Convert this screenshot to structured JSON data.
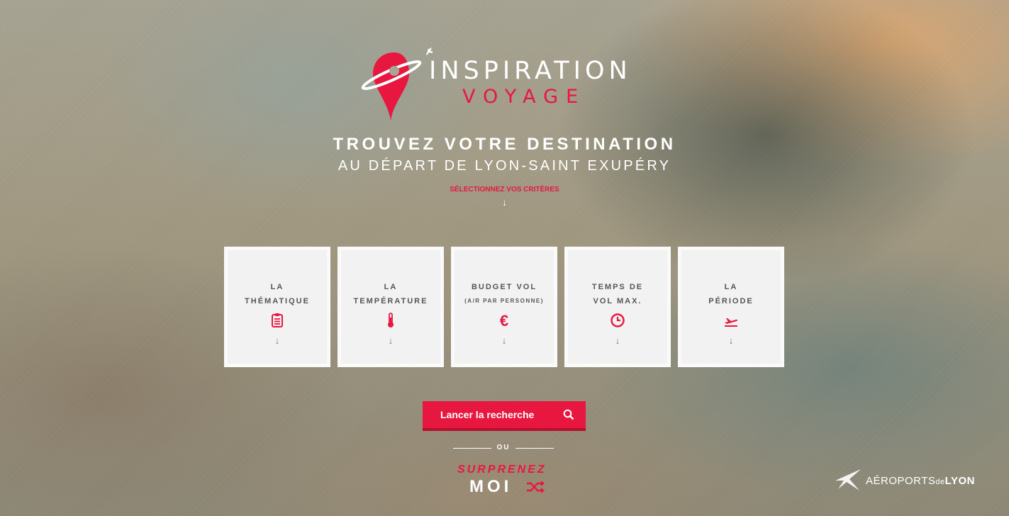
{
  "logo": {
    "line1": "INSPIRATION",
    "line2": "VOYAGE"
  },
  "hero": {
    "headline": "TROUVEZ VOTRE DESTINATION",
    "subheadline": "AU DÉPART DE LYON-SAINT EXUPÉRY",
    "criteria_hint": "SÉLECTIONNEZ VOS CRITÈRES",
    "arrow": "↓"
  },
  "criteria": [
    {
      "line1": "LA",
      "line2": "THÉMATIQUE",
      "icon": "clipboard-icon"
    },
    {
      "line1": "LA",
      "line2": "TEMPÉRATURE",
      "icon": "thermometer-icon"
    },
    {
      "line1": "BUDGET VOL",
      "note": "(A/R PAR PERSONNE)",
      "icon": "euro-icon"
    },
    {
      "line1": "TEMPS DE",
      "line2": "VOL MAX.",
      "icon": "clock-icon"
    },
    {
      "line1": "LA",
      "line2": "PÉRIODE",
      "icon": "plane-takeoff-icon"
    }
  ],
  "card_arrow": "↓",
  "search": {
    "label": "Lancer la recherche",
    "icon": "search-icon"
  },
  "or_label": "OU",
  "surprise": {
    "line1": "SURPRENEZ",
    "line2": "MOI",
    "icon": "shuffle-icon"
  },
  "partner": {
    "prefix": "AÉROPORTS",
    "middle": "de",
    "suffix": "LYON"
  },
  "colors": {
    "accent": "#e8173f",
    "card_bg": "#f2f2f2",
    "text": "#ffffff"
  }
}
